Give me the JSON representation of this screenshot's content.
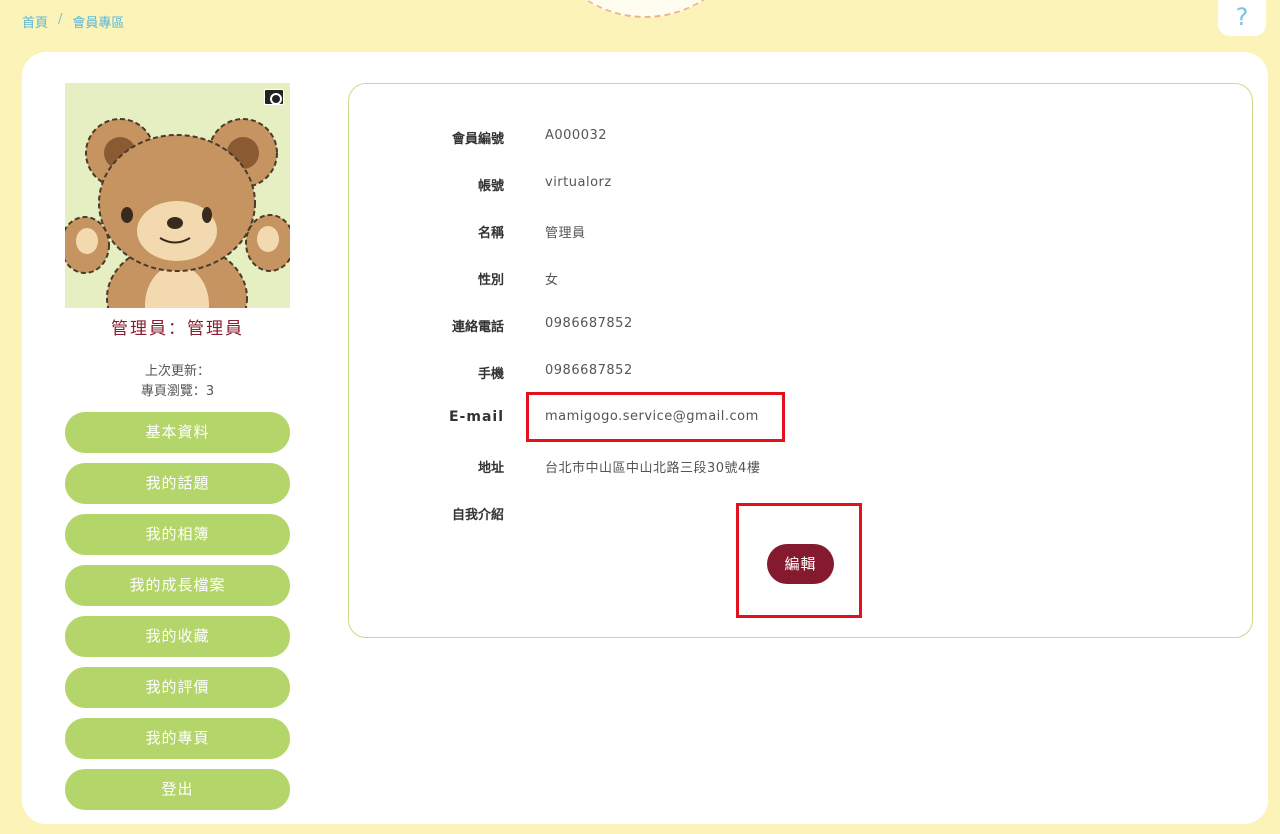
{
  "breadcrumb": [
    "首頁",
    "/",
    "會員專區"
  ],
  "help": "?",
  "profile": {
    "title": "管理員：管理員",
    "last_update": "上次更新：",
    "page_views": "專頁瀏覽：3"
  },
  "menu": [
    "基本資料",
    "我的話題",
    "我的相簿",
    "我的成長檔案",
    "我的收藏",
    "我的評價",
    "我的專頁",
    "登出"
  ],
  "fields": [
    {
      "label": "會員編號",
      "value": "A000032"
    },
    {
      "label": "帳號",
      "value": "virtualorz"
    },
    {
      "label": "名稱",
      "value": "管理員"
    },
    {
      "label": "性別",
      "value": "女"
    },
    {
      "label": "連絡電話",
      "value": "0986687852"
    },
    {
      "label": "手機",
      "value": "0986687852"
    },
    {
      "label": "E-mail",
      "value": "mamigogo.service@gmail.com"
    },
    {
      "label": "地址",
      "value": "台北市中山區中山北路三段30號4樓"
    },
    {
      "label": "自我介紹",
      "value": ""
    }
  ],
  "edit_label": "編輯",
  "icons": [
    "camera-icon",
    "bear-avatar"
  ],
  "colors": {
    "background": "#fbf3b8",
    "menu_button": "#b4d56a",
    "edit_button": "#851a2e",
    "highlight": "#e3111c",
    "breadcrumb": "#5bb7d8"
  }
}
